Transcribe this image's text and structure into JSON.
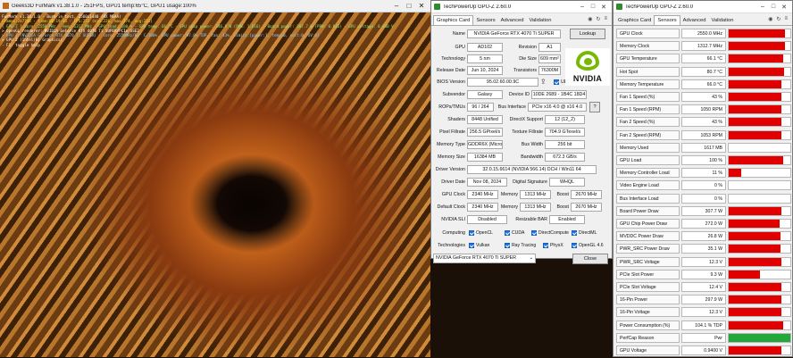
{
  "furmark": {
    "title": "Geeks3D FurMark v1.38.1.0 - 251FPS, GPU1 temp:65°C, GPU1 usage:100%",
    "overlay": [
      {
        "text": "FurMark v1.38.1.0 - Burn-in test, 2560x1440 (8X MSAA)",
        "color": "ov-w"
      },
      {
        "text": "Frames:287748 - time:00:19:05 - FPS:251 (min:226, max:274, avg:251)",
        "color": "ov-y"
      },
      {
        "text": "[ GPU-Z ] core: 2550 MHz - mem: 1312 MHz - GPU load: 100 % - GPU temp: 66 °C - GPU chip power: 246.8 W (PPW: 1.016) - Board power: 307.7 W (PPW: 0.816) - GPU voltage: 0.940 V",
        "color": "ov-g"
      },
      {
        "text": "> OpenGL renderer: NVIDIA GeForce RTX 4070 Ti SUPER/PCIe/SSE2",
        "color": "ov-w"
      },
      {
        "text": "> GPU 1 (NVIDIA GeForce RTX 4070 Ti SUPER) - core: 2550MHz/66° C/100%, GPU power: 97.8% TDP, fan: 43%, limits:[power:1, temp:0, volt:0, OV:0]",
        "color": "ov-c"
      },
      {
        "text": "> GPU 2 (Intel(R) Graphics)",
        "color": "ov-w"
      },
      {
        "text": "- F1: toggle help",
        "color": "ov-w"
      }
    ]
  },
  "gpuz_main": {
    "title": "TechPowerUp GPU-Z 2.60.0",
    "tabs": [
      "Graphics Card",
      "Sensors",
      "Advanced",
      "Validation"
    ],
    "active_tab": "Graphics Card",
    "labels": {
      "name": "Name",
      "gpu": "GPU",
      "revision": "Revision",
      "technology": "Technology",
      "die_size": "Die Size",
      "release_date": "Release Date",
      "transistors": "Transistors",
      "bios": "BIOS Version",
      "uefi": "UEFI",
      "subvendor": "Subvendor",
      "device_id": "Device ID",
      "rops": "ROPs/TMUs",
      "bus_interface": "Bus Interface",
      "shaders": "Shaders",
      "directx": "DirectX Support",
      "pixel_fillrate": "Pixel Fillrate",
      "texture_fillrate": "Texture Fillrate",
      "memory_type": "Memory Type",
      "bus_width": "Bus Width",
      "memory_size": "Memory Size",
      "bandwidth": "Bandwidth",
      "driver_version": "Driver Version",
      "driver_date": "Driver Date",
      "digital_signature": "Digital Signature",
      "gpu_clock": "GPU Clock",
      "memory": "Memory",
      "boost": "Boost",
      "default_clock": "Default Clock",
      "nvidia_sli": "NVIDIA SLI",
      "resizable_bar": "Resizable BAR",
      "computing": "Computing",
      "technologies": "Technologies"
    },
    "values": {
      "name": "NVIDIA GeForce RTX 4070 Ti SUPER",
      "lookup": "Lookup",
      "gpu": "AD102",
      "revision": "A1",
      "technology": "5 nm",
      "die_size": "609 mm²",
      "release_date": "Jun 10, 2024",
      "transistors": "76300M",
      "bios": "95.02.60.00.9C",
      "subvendor": "Galaxy",
      "device_id": "10DE 2689 - 1B4C 18D4",
      "rops": "96 / 264",
      "bus_interface": "PCIe x16 4.0 @ x16 4.0",
      "shaders": "8448 Unified",
      "directx": "12 (12_2)",
      "pixel_fillrate": "256.5 GPixel/s",
      "texture_fillrate": "704.9 GTexel/s",
      "memory_type": "GDDR6X (Micron)",
      "bus_width": "256 bit",
      "memory_size": "16384 MB",
      "bandwidth": "672.3 GB/s",
      "driver_version": "32.0.15.6614 (NVIDIA 566.14) DCH / Win11 64",
      "driver_date": "Nov 08, 2024",
      "digital_signature": "WHQL",
      "gpu_clock": "2340 MHz",
      "memory": "1313 MHz",
      "boost": "2670 MHz",
      "default_clock": "2340 MHz",
      "default_memory": "1313 MHz",
      "default_boost": "2670 MHz",
      "nvidia_sli": "Disabled",
      "resizable_bar": "Enabled",
      "selected_gpu": "NVIDIA GeForce RTX 4070 Ti SUPER",
      "close": "Close"
    },
    "computing": [
      "OpenCL",
      "CUDA",
      "DirectCompute",
      "DirectML"
    ],
    "technologies": [
      "Vulkan",
      "Ray Tracing",
      "PhysX",
      "OpenGL 4.6"
    ],
    "logo_text": "NVIDIA"
  },
  "gpuz_sensors": {
    "title": "TechPowerUp GPU-Z 2.60.0",
    "tabs": [
      "Graphics Card",
      "Sensors",
      "Advanced",
      "Validation"
    ],
    "active_tab": "Sensors",
    "bar_color": "#e00000",
    "rows": [
      {
        "label": "GPU Clock",
        "value": "2550.0 MHz",
        "level": 0.92
      },
      {
        "label": "Memory Clock",
        "value": "1312.7 MHz",
        "level": 0.92
      },
      {
        "label": "GPU Temperature",
        "value": "66.1 °C",
        "level": 0.88
      },
      {
        "label": "Hot Spot",
        "value": "80.7 °C",
        "level": 0.9
      },
      {
        "label": "Memory Temperature",
        "value": "66.0 °C",
        "level": 0.86
      },
      {
        "label": "Fan 1 Speed (%)",
        "value": "43 %",
        "level": 0.85
      },
      {
        "label": "Fan 1 Speed (RPM)",
        "value": "1050 RPM",
        "level": 0.85
      },
      {
        "label": "Fan 2 Speed (%)",
        "value": "43 %",
        "level": 0.85
      },
      {
        "label": "Fan 2 Speed (RPM)",
        "value": "1053 RPM",
        "level": 0.85
      },
      {
        "label": "Memory Used",
        "value": "1617 MB",
        "level": 0.0
      },
      {
        "label": "GPU Load",
        "value": "100 %",
        "level": 0.88
      },
      {
        "label": "Memory Controller Load",
        "value": "11 %",
        "level": 0.2
      },
      {
        "label": "Video Engine Load",
        "value": "0 %",
        "level": 0.0
      },
      {
        "label": "Bus Interface Load",
        "value": "0 %",
        "level": 0.0
      },
      {
        "label": "Board Power Draw",
        "value": "307.7 W",
        "level": 0.86
      },
      {
        "label": "GPU Chip Power Draw",
        "value": "272.0 W",
        "level": 0.82
      },
      {
        "label": "MVDDC Power Draw",
        "value": "26.8 W",
        "level": 0.84
      },
      {
        "label": "PWR_SRC Power Draw",
        "value": "35.1 W",
        "level": 0.84
      },
      {
        "label": "PWR_SRC Voltage",
        "value": "12.3 V",
        "level": 0.86
      },
      {
        "label": "PCIe Slot Power",
        "value": "9.3 W",
        "level": 0.5
      },
      {
        "label": "PCIe Slot Voltage",
        "value": "12.4 V",
        "level": 0.86
      },
      {
        "label": "16-Pin Power",
        "value": "297.9 W",
        "level": 0.86
      },
      {
        "label": "16-Pin Voltage",
        "value": "12.3 V",
        "level": 0.86
      },
      {
        "label": "Power Consumption (%)",
        "value": "104.1 % TDP",
        "level": 0.88
      },
      {
        "label": "PerfCap Reason",
        "value": "Pwr",
        "level": 1.0,
        "color": "#22a83a"
      },
      {
        "label": "GPU Voltage",
        "value": "0.9400 V",
        "level": 0.86
      }
    ]
  }
}
